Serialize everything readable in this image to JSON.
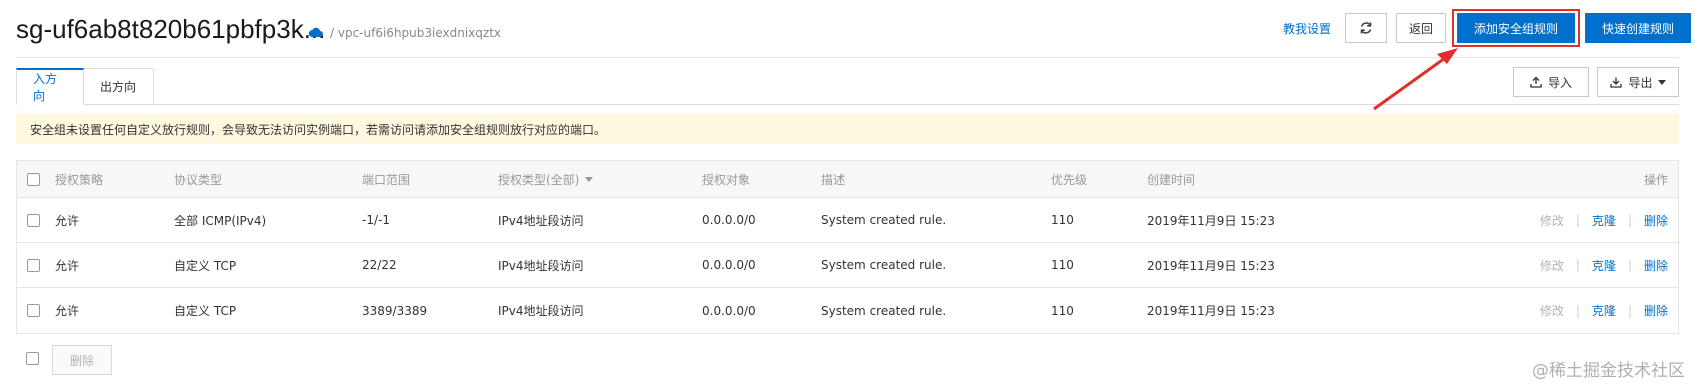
{
  "header": {
    "title": "sg-uf6ab8t820b61pbfp3k...",
    "path": "/ vpc-uf6i6hpub3iexdnixqztx",
    "help_link": "教我设置",
    "back_label": "返回",
    "add_rule_label": "添加安全组规则",
    "quick_create_label": "快速创建规则"
  },
  "tabs": [
    {
      "label": "入方向",
      "active": true
    },
    {
      "label": "出方向",
      "active": false
    }
  ],
  "toolbar": {
    "import_label": "导入",
    "export_label": "导出"
  },
  "warning": "安全组未设置任何自定义放行规则，会导致无法访问实例端口，若需访问请添加安全组规则放行对应的端口。",
  "table": {
    "columns": [
      "授权策略",
      "协议类型",
      "端口范围",
      "授权类型(全部)",
      "授权对象",
      "描述",
      "优先级",
      "创建时间",
      "操作"
    ],
    "rows": [
      {
        "policy": "允许",
        "protocol": "全部 ICMP(IPv4)",
        "port": "-1/-1",
        "auth_type": "IPv4地址段访问",
        "target": "0.0.0.0/0",
        "desc": "System created rule.",
        "priority": "110",
        "created": "2019年11月9日 15:23"
      },
      {
        "policy": "允许",
        "protocol": "自定义 TCP",
        "port": "22/22",
        "auth_type": "IPv4地址段访问",
        "target": "0.0.0.0/0",
        "desc": "System created rule.",
        "priority": "110",
        "created": "2019年11月9日 15:23"
      },
      {
        "policy": "允许",
        "protocol": "自定义 TCP",
        "port": "3389/3389",
        "auth_type": "IPv4地址段访问",
        "target": "0.0.0.0/0",
        "desc": "System created rule.",
        "priority": "110",
        "created": "2019年11月9日 15:23"
      }
    ],
    "ops": {
      "edit": "修改",
      "clone": "克隆",
      "delete": "删除"
    }
  },
  "footer": {
    "delete_label": "删除"
  },
  "watermark": "@稀土掘金技术社区",
  "colors": {
    "primary": "#0070cc",
    "highlight": "#e0302b",
    "warning_bg": "#fff8e1"
  }
}
